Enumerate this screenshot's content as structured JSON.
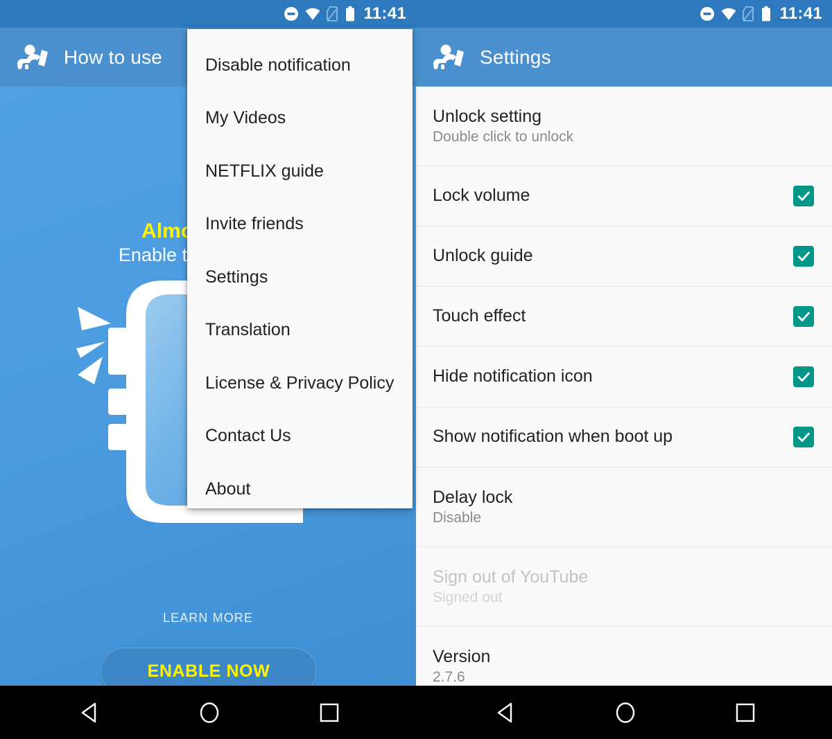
{
  "status_bar": {
    "time": "11:41",
    "icons": [
      "do-not-disturb-icon",
      "wifi-icon",
      "no-sim-icon",
      "battery-icon"
    ]
  },
  "left_screen": {
    "toolbar": {
      "title": "How to use",
      "icon": "baby-phone-app-icon"
    },
    "promo": {
      "headline": "Almost done!",
      "headline_visible": "Alm",
      "subtext": "Enable to lock screen",
      "subtext_visible": "Enable to lo"
    },
    "learn_more": "LEARN MORE",
    "enable_button": "ENABLE NOW",
    "pager": {
      "total": 4,
      "active_index": 2
    }
  },
  "overflow_menu": {
    "items": [
      {
        "label": "Disable notification"
      },
      {
        "label": "My Videos"
      },
      {
        "label": "NETFLIX guide"
      },
      {
        "label": "Invite friends"
      },
      {
        "label": "Settings"
      },
      {
        "label": "Translation"
      },
      {
        "label": "License & Privacy Policy"
      },
      {
        "label": "Contact Us"
      },
      {
        "label": "About"
      }
    ]
  },
  "right_screen": {
    "toolbar": {
      "title": "Settings",
      "icon": "baby-phone-app-icon"
    },
    "rows": [
      {
        "title": "Unlock setting",
        "subtitle": "Double click to unlock",
        "type": "two-line",
        "checkbox": null,
        "disabled": false
      },
      {
        "title": "Lock volume",
        "subtitle": "",
        "type": "one-line",
        "checkbox": true,
        "disabled": false
      },
      {
        "title": "Unlock guide",
        "subtitle": "",
        "type": "one-line",
        "checkbox": true,
        "disabled": false
      },
      {
        "title": "Touch effect",
        "subtitle": "",
        "type": "one-line",
        "checkbox": true,
        "disabled": false
      },
      {
        "title": "Hide notification icon",
        "subtitle": "",
        "type": "one-line",
        "checkbox": true,
        "disabled": false
      },
      {
        "title": "Show notification when boot up",
        "subtitle": "",
        "type": "one-line",
        "checkbox": true,
        "disabled": false
      },
      {
        "title": "Delay lock",
        "subtitle": "Disable",
        "type": "two-line",
        "checkbox": null,
        "disabled": false
      },
      {
        "title": "Sign out of YouTube",
        "subtitle": "Signed out",
        "type": "two-line",
        "checkbox": null,
        "disabled": true
      },
      {
        "title": "Version",
        "subtitle": "2.7.6",
        "type": "two-line",
        "checkbox": null,
        "disabled": false
      }
    ]
  },
  "nav_bar": {
    "buttons": [
      "back-nav-button",
      "home-nav-button",
      "recents-nav-button"
    ]
  },
  "colors": {
    "status_bar": "#2E78BE",
    "toolbar": "#4A90CE",
    "left_background": "#4A9BE0",
    "accent_yellow": "#FFF400",
    "checkbox_teal": "#009688",
    "list_background": "#FAFAFA",
    "nav_bar": "#000000"
  }
}
